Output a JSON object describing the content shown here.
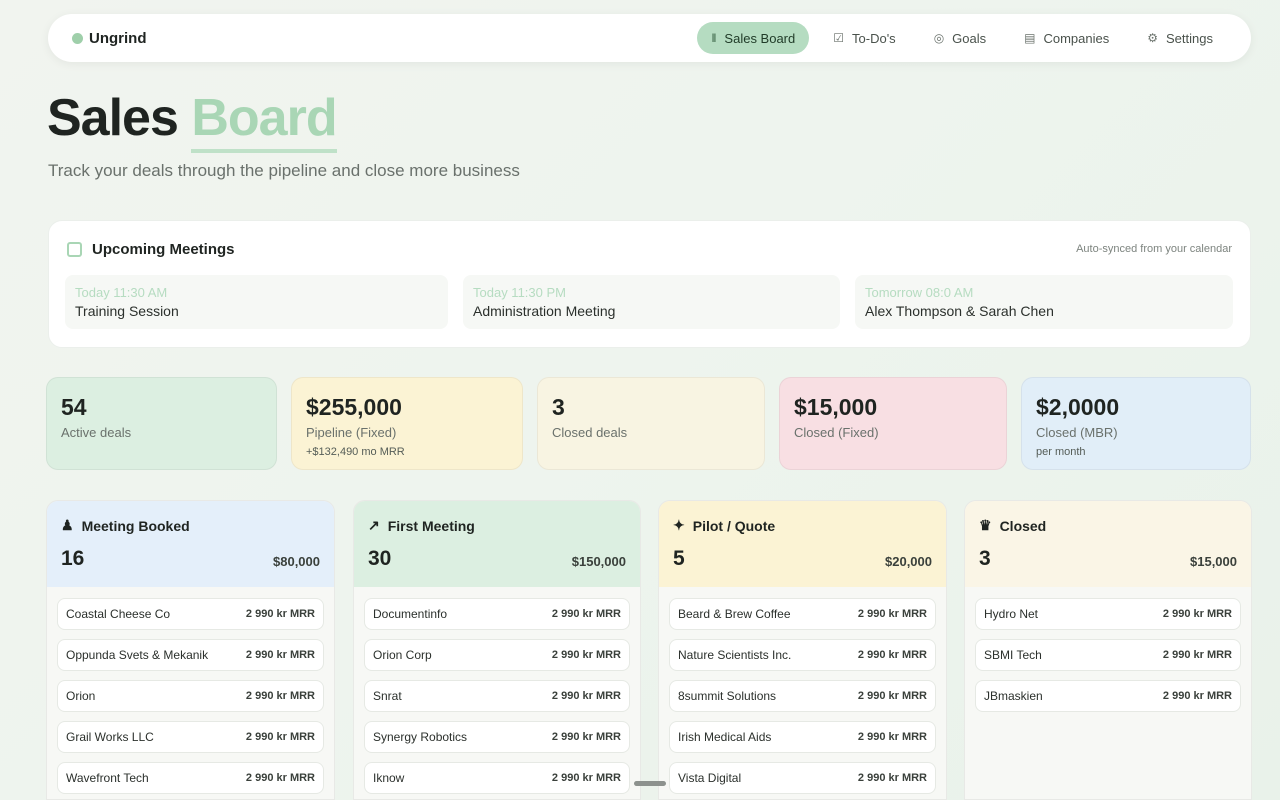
{
  "app": {
    "name": "Ungrind"
  },
  "nav": {
    "items": [
      {
        "label": "Sales Board",
        "icon": "bars-icon"
      },
      {
        "label": "To-Do's",
        "icon": "checkbox-icon"
      },
      {
        "label": "Goals",
        "icon": "target-icon"
      },
      {
        "label": "Companies",
        "icon": "building-icon"
      },
      {
        "label": "Settings",
        "icon": "gear-icon"
      }
    ]
  },
  "page": {
    "title_main": "Sales",
    "title_accent": "Board",
    "subtitle": "Track your deals through the pipeline and close more business"
  },
  "meetings": {
    "title": "Upcoming Meetings",
    "note": "Auto-synced from your calendar",
    "items": [
      {
        "time": "Today 11:30 AM",
        "title": "Training Session"
      },
      {
        "time": "Today 11:30 PM",
        "title": "Administration Meeting"
      },
      {
        "time": "Tomorrow 08:0 AM",
        "title": "Alex Thompson & Sarah Chen"
      }
    ]
  },
  "stats": [
    {
      "value": "54",
      "label": "Active deals",
      "sub": ""
    },
    {
      "value": "$255,000",
      "label": "Pipeline (Fixed)",
      "sub": "+$132,490 mo MRR"
    },
    {
      "value": "3",
      "label": "Closed deals",
      "sub": ""
    },
    {
      "value": "$15,000",
      "label": "Closed (Fixed)",
      "sub": ""
    },
    {
      "value": "$2,0000",
      "label": "Closed (MBR)",
      "sub": "per month"
    }
  ],
  "columns": [
    {
      "title": "Meeting Booked",
      "count": "16",
      "total": "$80,000",
      "deals": [
        {
          "name": "Coastal Cheese Co",
          "mrr": "2 990 kr MRR"
        },
        {
          "name": "Oppunda Svets & Mekanik",
          "mrr": "2 990 kr MRR"
        },
        {
          "name": "Orion",
          "mrr": "2 990 kr MRR"
        },
        {
          "name": "Grail Works LLC",
          "mrr": "2 990 kr MRR"
        },
        {
          "name": "Wavefront Tech",
          "mrr": "2 990 kr MRR"
        }
      ]
    },
    {
      "title": "First Meeting",
      "count": "30",
      "total": "$150,000",
      "deals": [
        {
          "name": "Documentinfo",
          "mrr": "2 990 kr MRR"
        },
        {
          "name": "Orion Corp",
          "mrr": "2 990 kr MRR"
        },
        {
          "name": "Snrat",
          "mrr": "2 990 kr MRR"
        },
        {
          "name": "Synergy Robotics",
          "mrr": "2 990 kr MRR"
        },
        {
          "name": "Iknow",
          "mrr": "2 990 kr MRR"
        }
      ]
    },
    {
      "title": "Pilot / Quote",
      "count": "5",
      "total": "$20,000",
      "deals": [
        {
          "name": "Beard & Brew Coffee",
          "mrr": "2 990 kr MRR"
        },
        {
          "name": "Nature Scientists Inc.",
          "mrr": "2 990 kr MRR"
        },
        {
          "name": "8summit Solutions",
          "mrr": "2 990 kr MRR"
        },
        {
          "name": "Irish Medical Aids",
          "mrr": "2 990 kr MRR"
        },
        {
          "name": "Vista Digital",
          "mrr": "2 990 kr MRR"
        }
      ]
    },
    {
      "title": "Closed",
      "count": "3",
      "total": "$15,000",
      "deals": [
        {
          "name": "Hydro Net",
          "mrr": "2 990 kr MRR"
        },
        {
          "name": "SBMI Tech",
          "mrr": "2 990 kr MRR"
        },
        {
          "name": "JBmaskien",
          "mrr": "2 990 kr MRR"
        }
      ]
    }
  ],
  "colors": {
    "accent": "#a9d6b5",
    "nav_active": "#b5dcc1",
    "stat_green": "#dcefe1",
    "stat_yellow": "#fbf3d4",
    "stat_cream": "#f8f4e2",
    "stat_pink": "#f8dfe3",
    "stat_blue": "#e1eef8",
    "col_blue": "#e4effa",
    "col_green": "#dcefe1",
    "col_yellow": "#fbf3d4",
    "col_cream": "#faf5e6"
  }
}
